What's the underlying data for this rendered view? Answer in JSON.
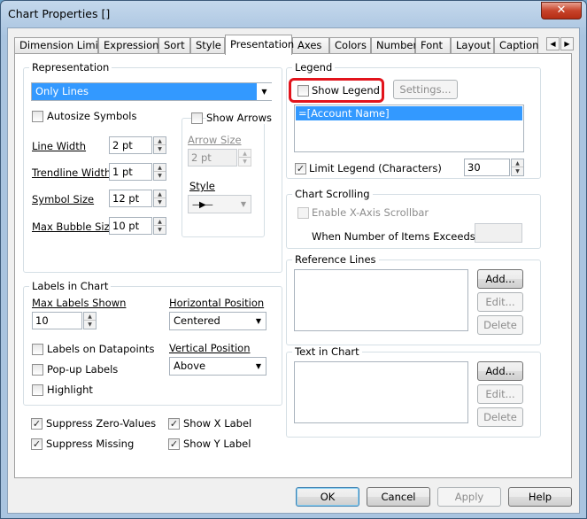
{
  "window": {
    "title": "Chart Properties []",
    "close_glyph": "✕"
  },
  "tabs": [
    "Dimension Limits",
    "Expressions",
    "Sort",
    "Style",
    "Presentation",
    "Axes",
    "Colors",
    "Number",
    "Font",
    "Layout",
    "Caption"
  ],
  "active_tab": "Presentation",
  "tab_scroll": {
    "left": "◀",
    "right": "▶"
  },
  "representation": {
    "label": "Representation",
    "value": "Only Lines",
    "autosize_symbols": {
      "label": "Autosize Symbols",
      "checked": false
    },
    "line_width": {
      "label": "Line Width",
      "value": "2 pt"
    },
    "trendline_width": {
      "label": "Trendline Width",
      "value": "1 pt"
    },
    "symbol_size": {
      "label": "Symbol Size",
      "value": "12 pt"
    },
    "max_bubble_size": {
      "label": "Max Bubble Size",
      "value": "10 pt"
    },
    "show_arrows": {
      "label": "Show Arrows",
      "checked": false
    },
    "arrow_size": {
      "label": "Arrow Size",
      "value": "2 pt"
    },
    "style": {
      "label": "Style"
    }
  },
  "labels_in_chart": {
    "label": "Labels in Chart",
    "max_labels_shown": {
      "label": "Max Labels Shown",
      "value": "10"
    },
    "horizontal_position": {
      "label": "Horizontal Position",
      "value": "Centered"
    },
    "vertical_position": {
      "label": "Vertical Position",
      "value": "Above"
    },
    "labels_on_datapoints": {
      "label": "Labels on Datapoints",
      "checked": false
    },
    "popup_labels": {
      "label": "Pop-up Labels",
      "checked": false
    },
    "highlight": {
      "label": "Highlight",
      "checked": false
    }
  },
  "bottom_checks": {
    "suppress_zero": {
      "label": "Suppress Zero-Values",
      "checked": true
    },
    "suppress_missing": {
      "label": "Suppress Missing",
      "checked": true
    },
    "show_x_label": {
      "label": "Show X Label",
      "checked": true
    },
    "show_y_label": {
      "label": "Show Y Label",
      "checked": true
    }
  },
  "legend": {
    "label": "Legend",
    "show_legend": {
      "label": "Show Legend",
      "checked": false
    },
    "settings_button": "Settings...",
    "list_item": "=[Account Name]",
    "limit_legend": {
      "label": "Limit Legend (Characters)",
      "checked": true,
      "value": "30"
    }
  },
  "chart_scrolling": {
    "label": "Chart Scrolling",
    "enable_x_scrollbar": {
      "label": "Enable X-Axis Scrollbar",
      "checked": false
    },
    "items_exceeds_label": "When Number of Items Exceeds:"
  },
  "reference_lines": {
    "label": "Reference Lines",
    "add": "Add...",
    "edit": "Edit...",
    "delete": "Delete"
  },
  "text_in_chart": {
    "label": "Text in Chart",
    "add": "Add...",
    "edit": "Edit...",
    "delete": "Delete"
  },
  "footer": {
    "ok": "OK",
    "cancel": "Cancel",
    "apply": "Apply",
    "help": "Help"
  },
  "colors": {
    "selection": "#3399ff",
    "annotation_ring": "#e2141c"
  },
  "glyphs": {
    "check": "✓",
    "dropdown": "▼",
    "spin_up": "▲",
    "spin_down": "▼",
    "arrow_style": "—▶—"
  }
}
